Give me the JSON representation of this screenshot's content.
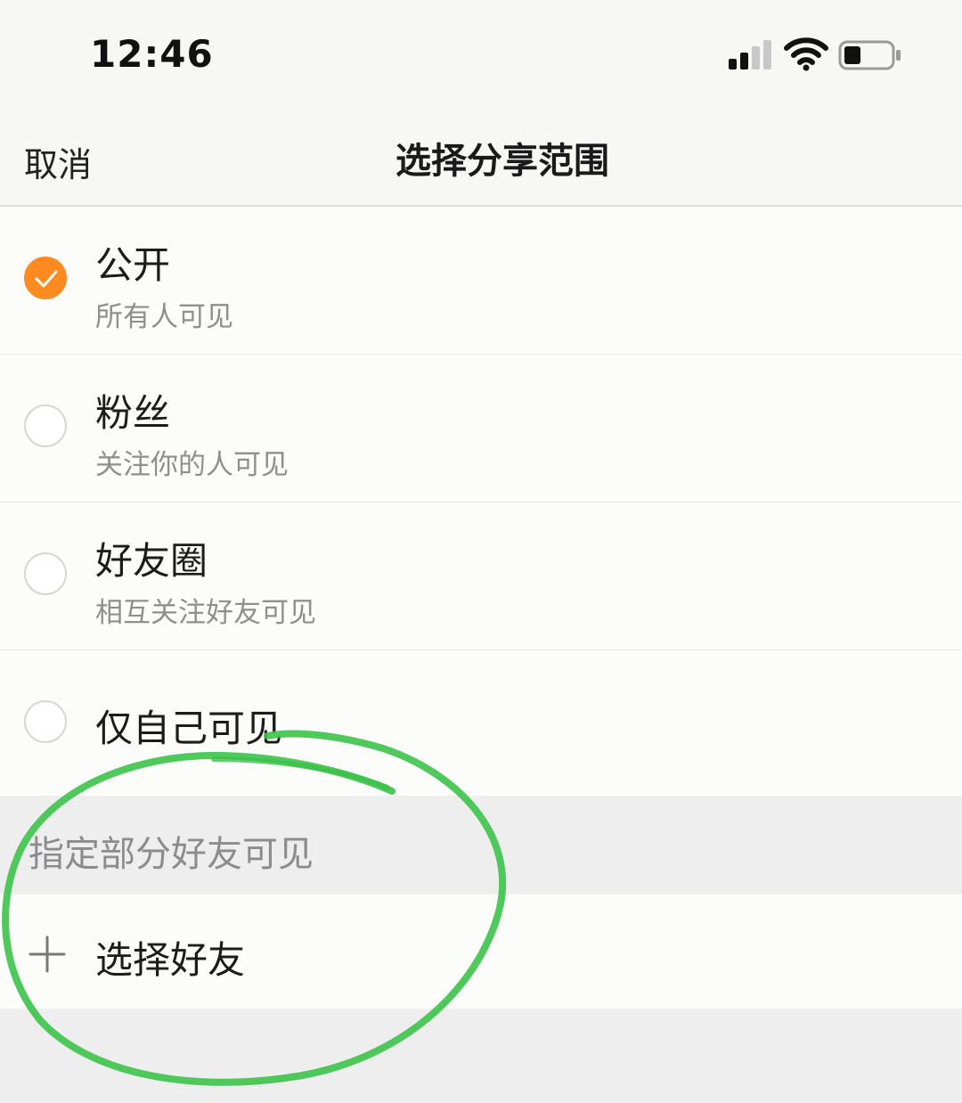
{
  "status_bar": {
    "time": "12:46"
  },
  "nav": {
    "cancel_label": "取消",
    "title": "选择分享范围"
  },
  "options": [
    {
      "title": "公开",
      "subtitle": "所有人可见",
      "selected": true
    },
    {
      "title": "粉丝",
      "subtitle": "关注你的人可见",
      "selected": false
    },
    {
      "title": "好友圈",
      "subtitle": "相互关注好友可见",
      "selected": false
    },
    {
      "title": "仅自己可见",
      "selected": false
    }
  ],
  "partial_section": {
    "header": "指定部分好友可见",
    "select_label": "选择好友"
  },
  "colors": {
    "accent": "#ff8a1f",
    "annotation": "#3cc24a"
  },
  "icons": [
    "signal-icon",
    "wifi-icon",
    "battery-icon",
    "checkmark-icon",
    "plus-icon"
  ]
}
